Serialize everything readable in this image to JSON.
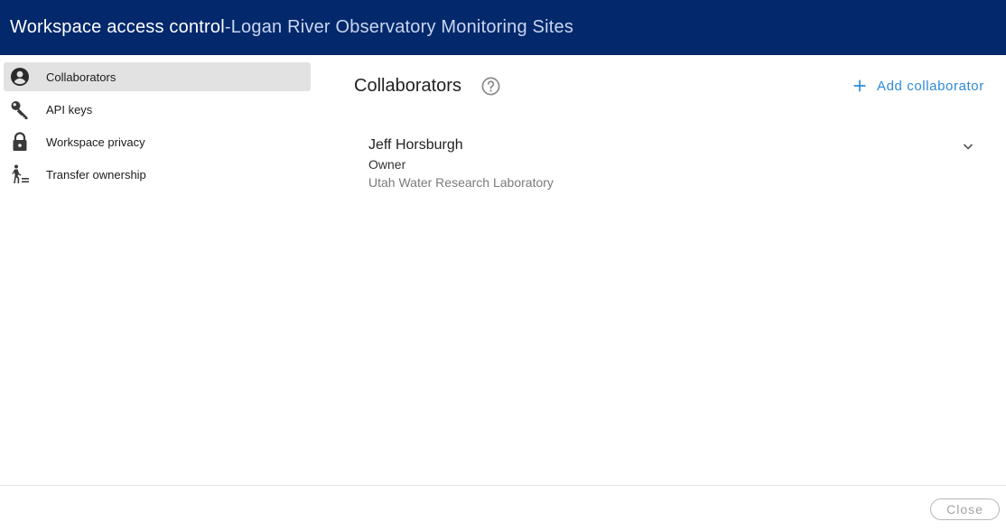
{
  "header": {
    "title": "Workspace access control",
    "separator": " - ",
    "workspace": "Logan River Observatory Monitoring Sites"
  },
  "sidebar": {
    "items": [
      {
        "label": "Collaborators",
        "icon": "account-circle-icon",
        "active": true
      },
      {
        "label": "API keys",
        "icon": "key-icon",
        "active": false
      },
      {
        "label": "Workspace privacy",
        "icon": "lock-icon",
        "active": false
      },
      {
        "label": "Transfer ownership",
        "icon": "transfer-person-icon",
        "active": false
      }
    ]
  },
  "main": {
    "title": "Collaborators",
    "help_icon": "help-circle-icon",
    "add_label": "Add collaborator",
    "collaborators": [
      {
        "name": "Jeff Horsburgh",
        "role": "Owner",
        "organization": "Utah Water Research Laboratory"
      }
    ]
  },
  "footer": {
    "close_label": "Close"
  },
  "colors": {
    "header_bg": "#03286b",
    "accent": "#2c8ad8",
    "active_item_bg": "#e2e2e2"
  }
}
